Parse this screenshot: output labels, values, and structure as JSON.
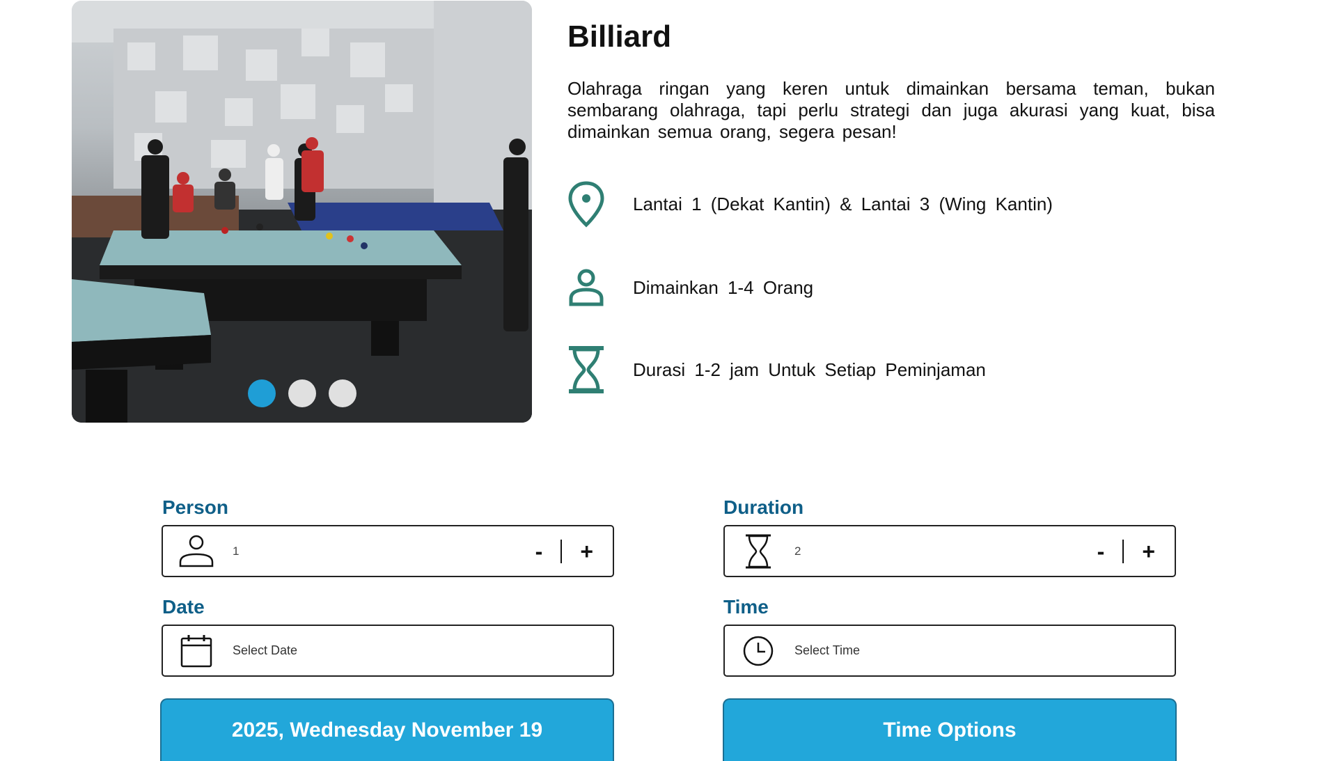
{
  "facility": {
    "title": "Billiard",
    "description": "Olahraga ringan yang keren untuk dimainkan bersama teman, bukan sembarang olahraga, tapi perlu strategi dan juga akurasi yang kuat, bisa dimainkan semua orang, segera pesan!",
    "features": [
      {
        "icon": "location-pin-icon",
        "text": "Lantai 1 (Dekat Kantin) & Lantai 3 (Wing Kantin)"
      },
      {
        "icon": "person-icon",
        "text": "Dimainkan 1-4 Orang"
      },
      {
        "icon": "hourglass-icon",
        "text": "Durasi 1-2 jam Untuk Setiap Peminjaman"
      }
    ]
  },
  "carousel": {
    "slide_count": 3,
    "active_index": 0
  },
  "form": {
    "person": {
      "label": "Person",
      "value": "1",
      "minus": "-",
      "plus": "+"
    },
    "duration": {
      "label": "Duration",
      "value": "2",
      "minus": "-",
      "plus": "+"
    },
    "date": {
      "label": "Date",
      "placeholder": "Select Date"
    },
    "time": {
      "label": "Time",
      "placeholder": "Select Time"
    },
    "date_button": "2025, Wednesday November 19",
    "time_button": "Time Options"
  },
  "colors": {
    "accent": "#22a7da",
    "label": "#0f5f88",
    "icon_teal": "#2f7f73",
    "active_dot": "#1f9ed6"
  }
}
